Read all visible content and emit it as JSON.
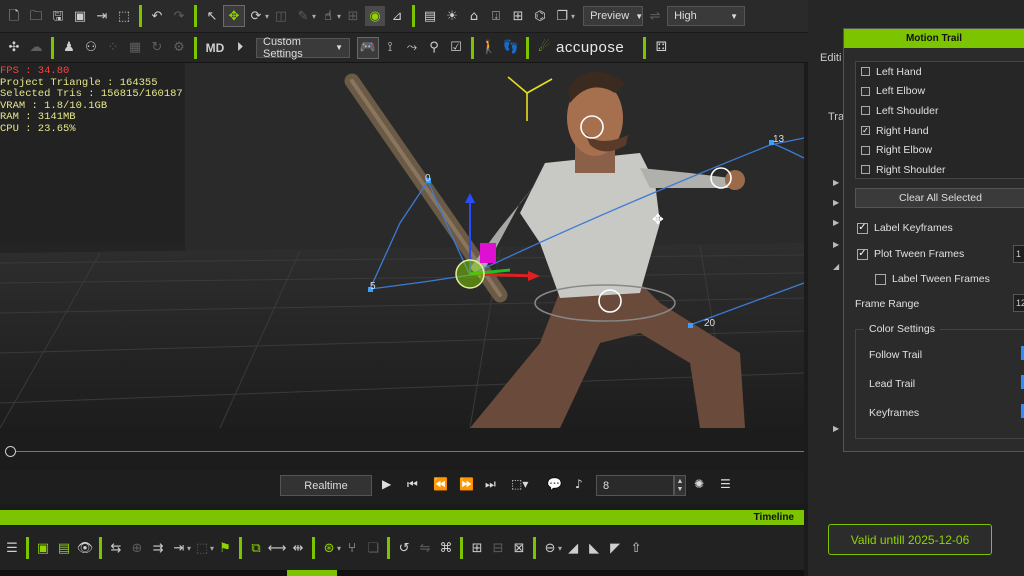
{
  "toolbar": {
    "preview_label": "Preview",
    "quality_label": "High",
    "custom_settings_label": "Custom Settings",
    "brand_label": "accupose",
    "icons_row1": [
      "new-file-icon",
      "open-folder-icon",
      "save-icon",
      "save-as-icon",
      "export-icon",
      "usd-export-icon",
      "undo-icon",
      "redo-icon",
      "select-arrow-icon",
      "move-icon",
      "rotate-icon",
      "scale-icon",
      "paint-icon",
      "hand-tool-icon",
      "eye-icon",
      "pivot-icon",
      "layout-icon",
      "sun-icon",
      "light-icon",
      "import-icon",
      "add-icon",
      "network-icon",
      "window-icon"
    ],
    "icons_row2": [
      "gizmo-icon",
      "cloud-icon",
      "person-settings-icon",
      "people-icon",
      "dots-icon",
      "grid-icon",
      "refresh-icon",
      "settings-icon",
      "md-icon",
      "play-circle-icon",
      "gamepad-icon",
      "curve-tool-icon",
      "path-tool-icon",
      "motion-tool-icon",
      "checklist-icon",
      "walk-icon",
      "footprint-icon",
      "crowd-icon"
    ]
  },
  "stats": {
    "fps": "FPS : 34.80",
    "project_triangles": "Project Triangle : 164355",
    "selected_tris": "Selected Tris : 156815/160187",
    "vram": "VRAM : 1.8/10.1GB",
    "ram": "RAM : 3141MB",
    "cpu": "CPU : 23.65%"
  },
  "viewport": {
    "frame_labels": [
      "0",
      "5",
      "13",
      "20"
    ]
  },
  "playback": {
    "realtime_label": "Realtime",
    "frame_value": "8"
  },
  "timeline": {
    "header_label": "Timeline"
  },
  "right_panel": {
    "edit_tab": "Editi",
    "trail_tab": "Tra",
    "valid_label": "Valid untill 2025-12-06"
  },
  "motion_trail": {
    "title": "Motion Trail",
    "joints": [
      {
        "label": "Left Hand",
        "checked": false
      },
      {
        "label": "Left Elbow",
        "checked": false
      },
      {
        "label": "Left Shoulder",
        "checked": false
      },
      {
        "label": "Right Hand",
        "checked": true
      },
      {
        "label": "Right Elbow",
        "checked": false
      },
      {
        "label": "Right Shoulder",
        "checked": false
      }
    ],
    "clear_label": "Clear All Selected",
    "label_keyframes": "Label Keyframes",
    "plot_tween": "Plot Tween Frames",
    "label_tween": "Label Tween Frames",
    "frame_range": "Frame Range",
    "color_settings": "Color Settings",
    "follow_trail": "Follow Trail",
    "lead_trail": "Lead Trail",
    "keyframes": "Keyframes",
    "plot_value": "1",
    "range_value": "12",
    "trail_color": "#2d8cff",
    "accent_color": "#7cc400"
  }
}
